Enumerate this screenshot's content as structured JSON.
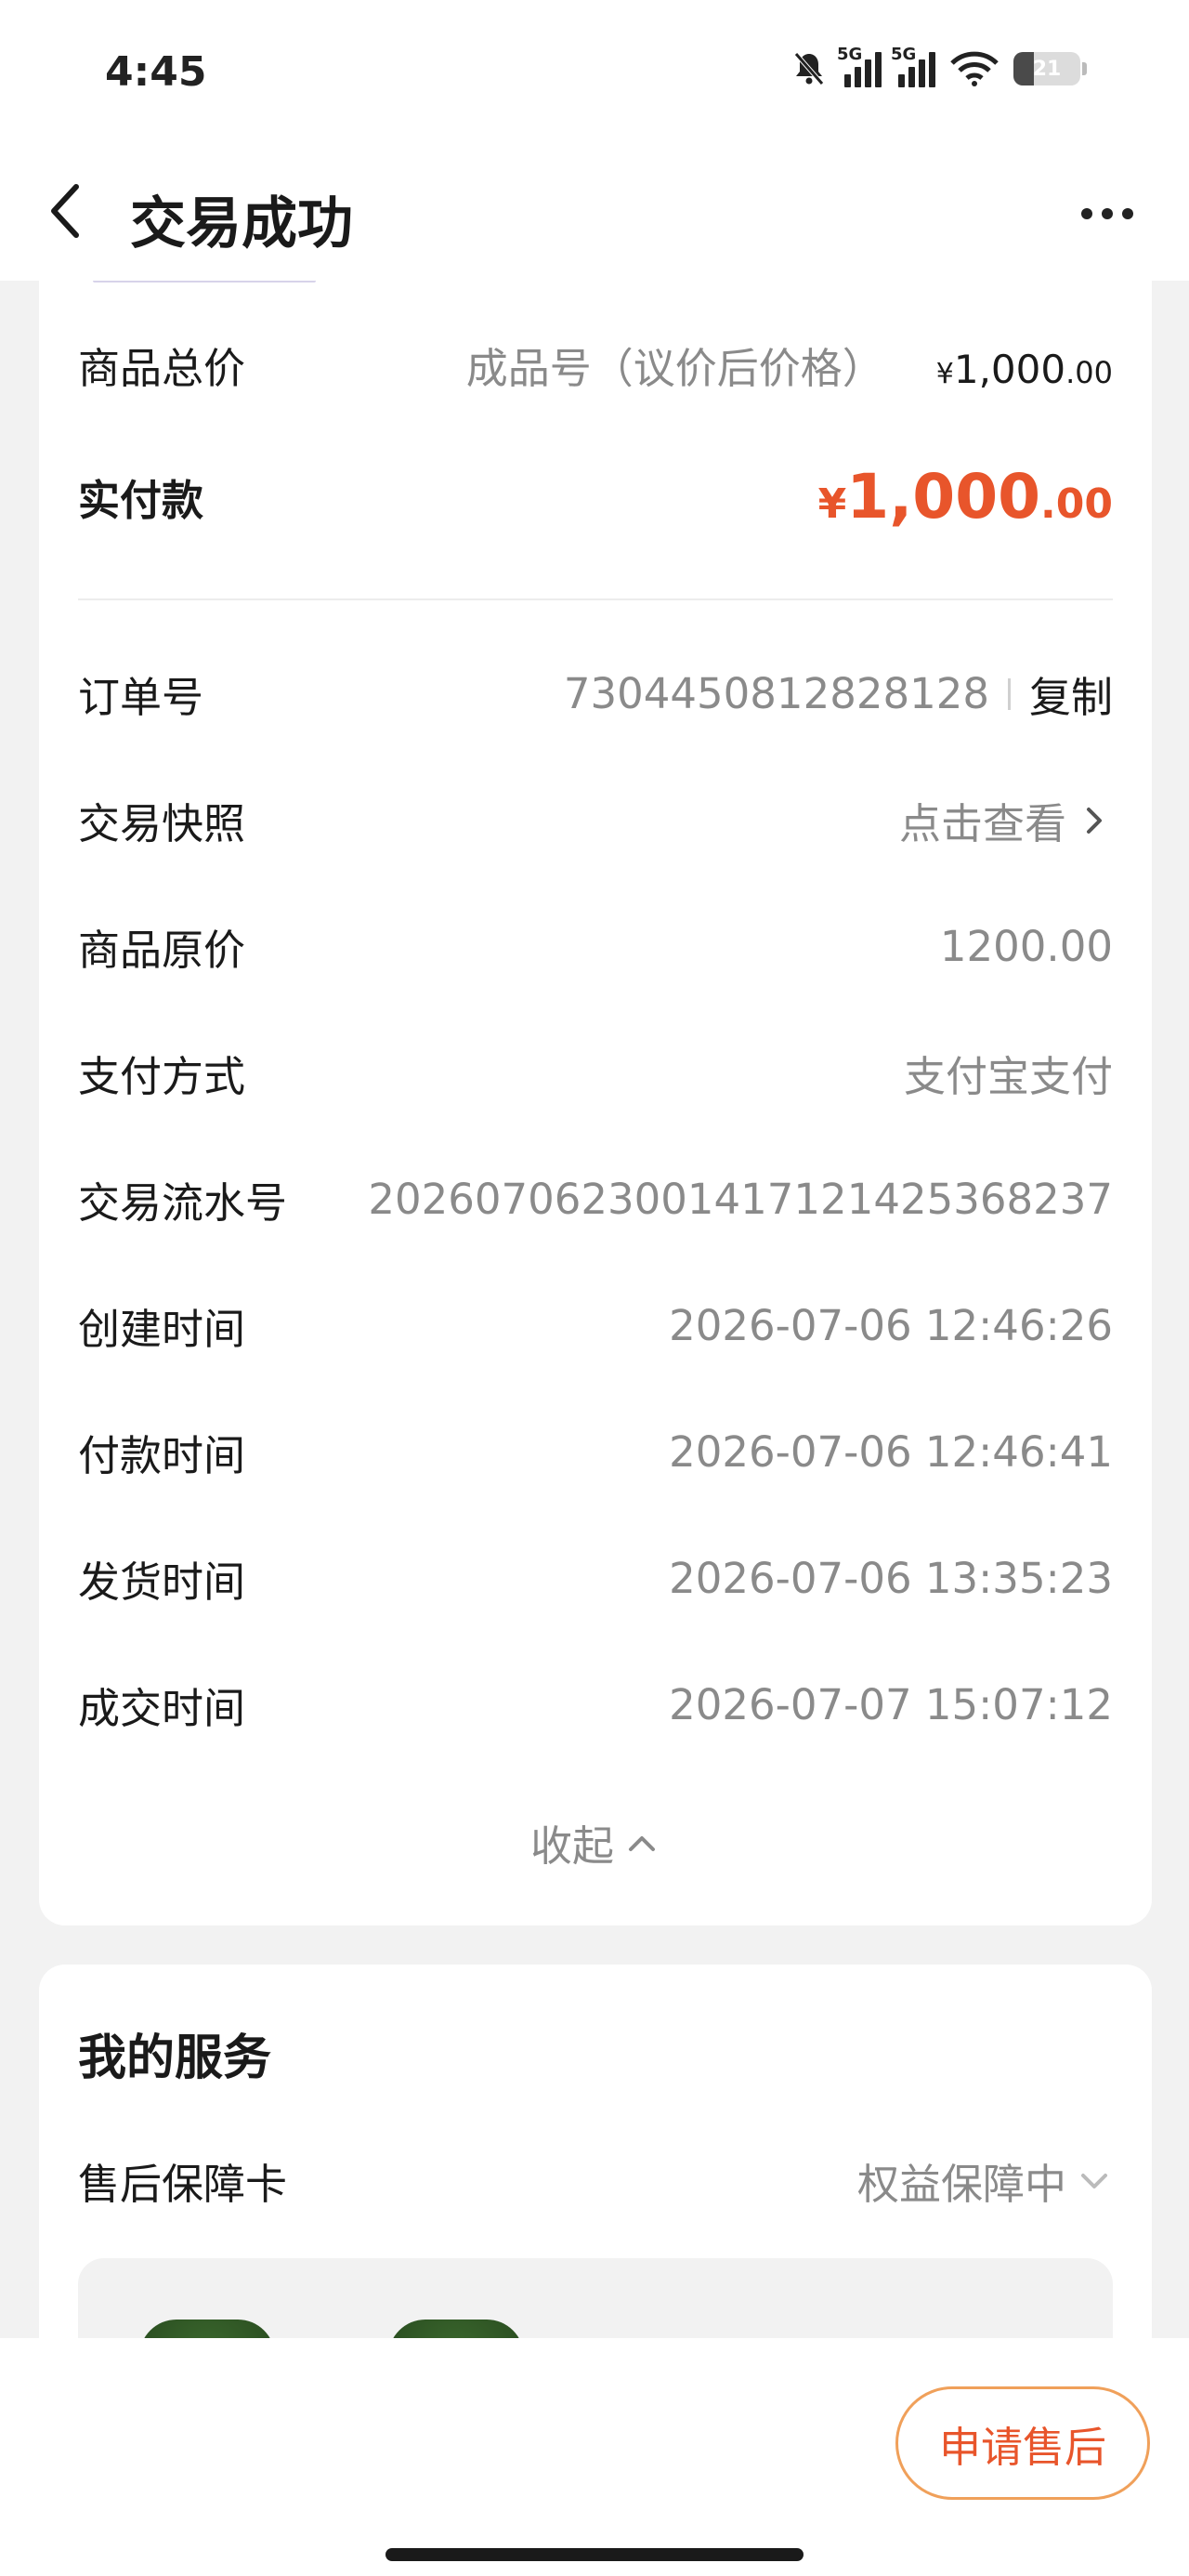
{
  "status_bar": {
    "time": "4:45",
    "network_1": "5G",
    "network_2": "5G",
    "battery": "21"
  },
  "header": {
    "title": "交易成功"
  },
  "price": {
    "total_label": "商品总价",
    "total_note": "成品号（议价后价格）",
    "total_currency": "¥",
    "total_integer": "1,000",
    "total_decimal": ".00",
    "paid_label": "实付款",
    "paid_currency": "¥",
    "paid_integer": "1,000",
    "paid_decimal": ".00"
  },
  "order": {
    "order_no_label": "订单号",
    "order_no": "7304450812828128",
    "copy_label": "复制",
    "snapshot_label": "交易快照",
    "snapshot_value": "点击查看",
    "original_price_label": "商品原价",
    "original_price": "1200.00",
    "pay_method_label": "支付方式",
    "pay_method": "支付宝支付",
    "serial_label": "交易流水号",
    "serial": "2026070623001417121425368237",
    "created_label": "创建时间",
    "created": "2026-07-06 12:46:26",
    "paid_time_label": "付款时间",
    "paid_time": "2026-07-06 12:46:41",
    "shipped_label": "发货时间",
    "shipped": "2026-07-06 13:35:23",
    "completed_label": "成交时间",
    "completed": "2026-07-07 15:07:12",
    "collapse_label": "收起"
  },
  "services": {
    "title": "我的服务",
    "card_label": "售后保障卡",
    "card_status": "权益保障中"
  },
  "footer": {
    "aftersale_button": "申请售后"
  },
  "colors": {
    "accent": "#e8552b",
    "button_border": "#f0a05a",
    "muted_text": "#8a8a8a"
  }
}
